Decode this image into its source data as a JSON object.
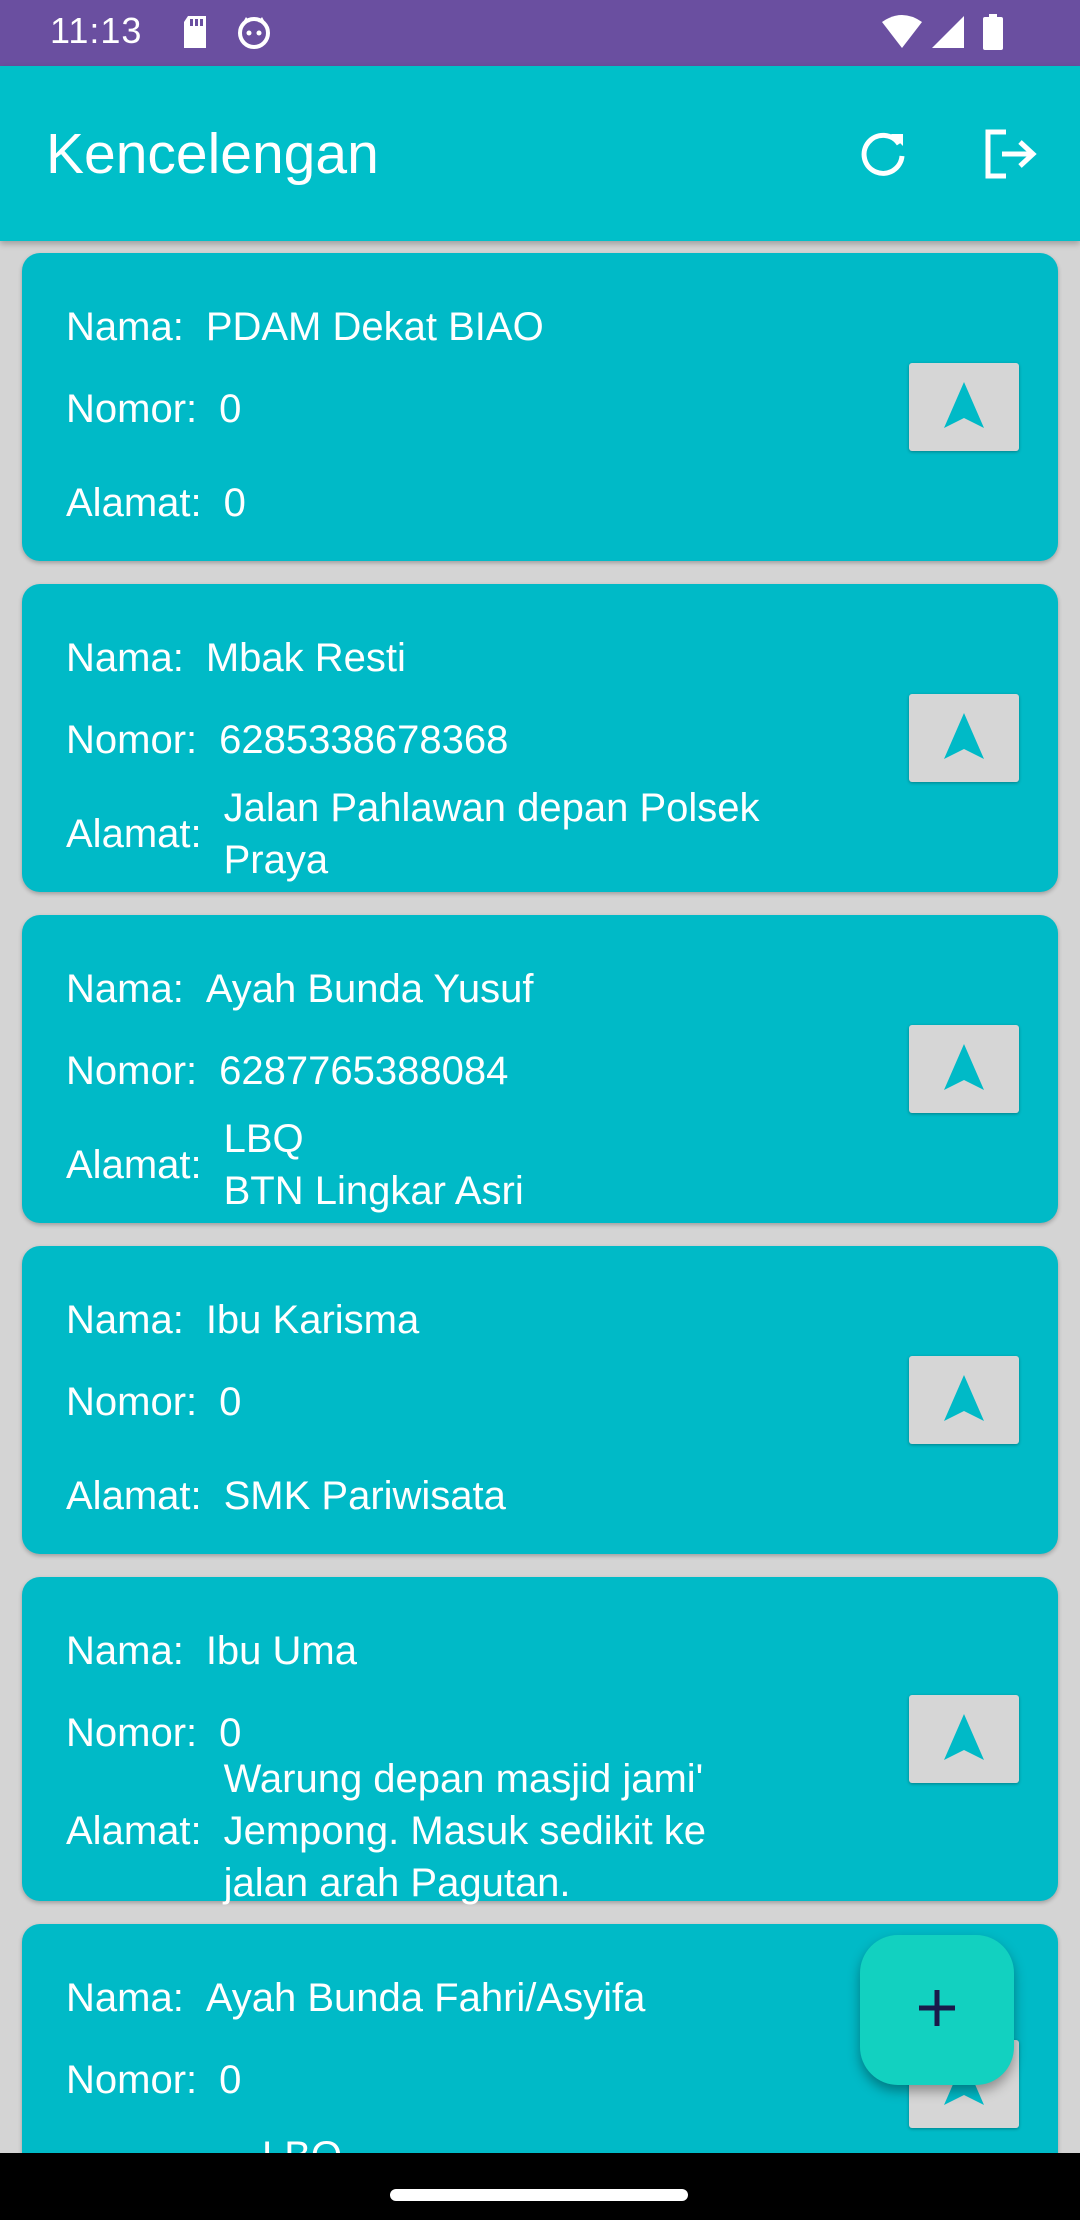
{
  "status_bar": {
    "time": "11:13",
    "icons_left": [
      "sd-card-icon",
      "cat-face-icon"
    ],
    "icons_right": [
      "wifi-icon",
      "signal-icon",
      "battery-icon"
    ]
  },
  "app_bar": {
    "title": "Kencelengan",
    "actions": [
      "refresh-icon",
      "logout-icon"
    ],
    "color": "#00bfc9"
  },
  "labels": {
    "nama": "Nama:",
    "nomor": "Nomor:",
    "alamat": "Alamat:"
  },
  "cards": [
    {
      "nama": "PDAM Dekat BIAO",
      "nomor": "0",
      "alamat": "0"
    },
    {
      "nama": "Mbak Resti",
      "nomor": "6285338678368",
      "alamat": "Jalan Pahlawan depan Polsek Praya"
    },
    {
      "nama": "Ayah Bunda Yusuf",
      "nomor": "6287765388084",
      "alamat": "LBQ\nBTN Lingkar Asri"
    },
    {
      "nama": "Ibu Karisma",
      "nomor": "0",
      "alamat": "SMK Pariwisata"
    },
    {
      "nama": "Ibu Uma",
      "nomor": "0",
      "alamat": "Warung depan masjid jami' Jempong. Masuk sedikit ke jalan arah Pagutan."
    },
    {
      "nama": "Ayah Bunda Fahri/Asyifa",
      "nomor": "0",
      "alamat": "LBQ"
    }
  ],
  "card_action_icon": "navigation-arrow-icon",
  "fab_icon": "plus-icon",
  "colors": {
    "status_bar": "#6a4fa0",
    "card": "#00bac7",
    "fab": "#12d1c0",
    "background": "#d4d4d4"
  }
}
